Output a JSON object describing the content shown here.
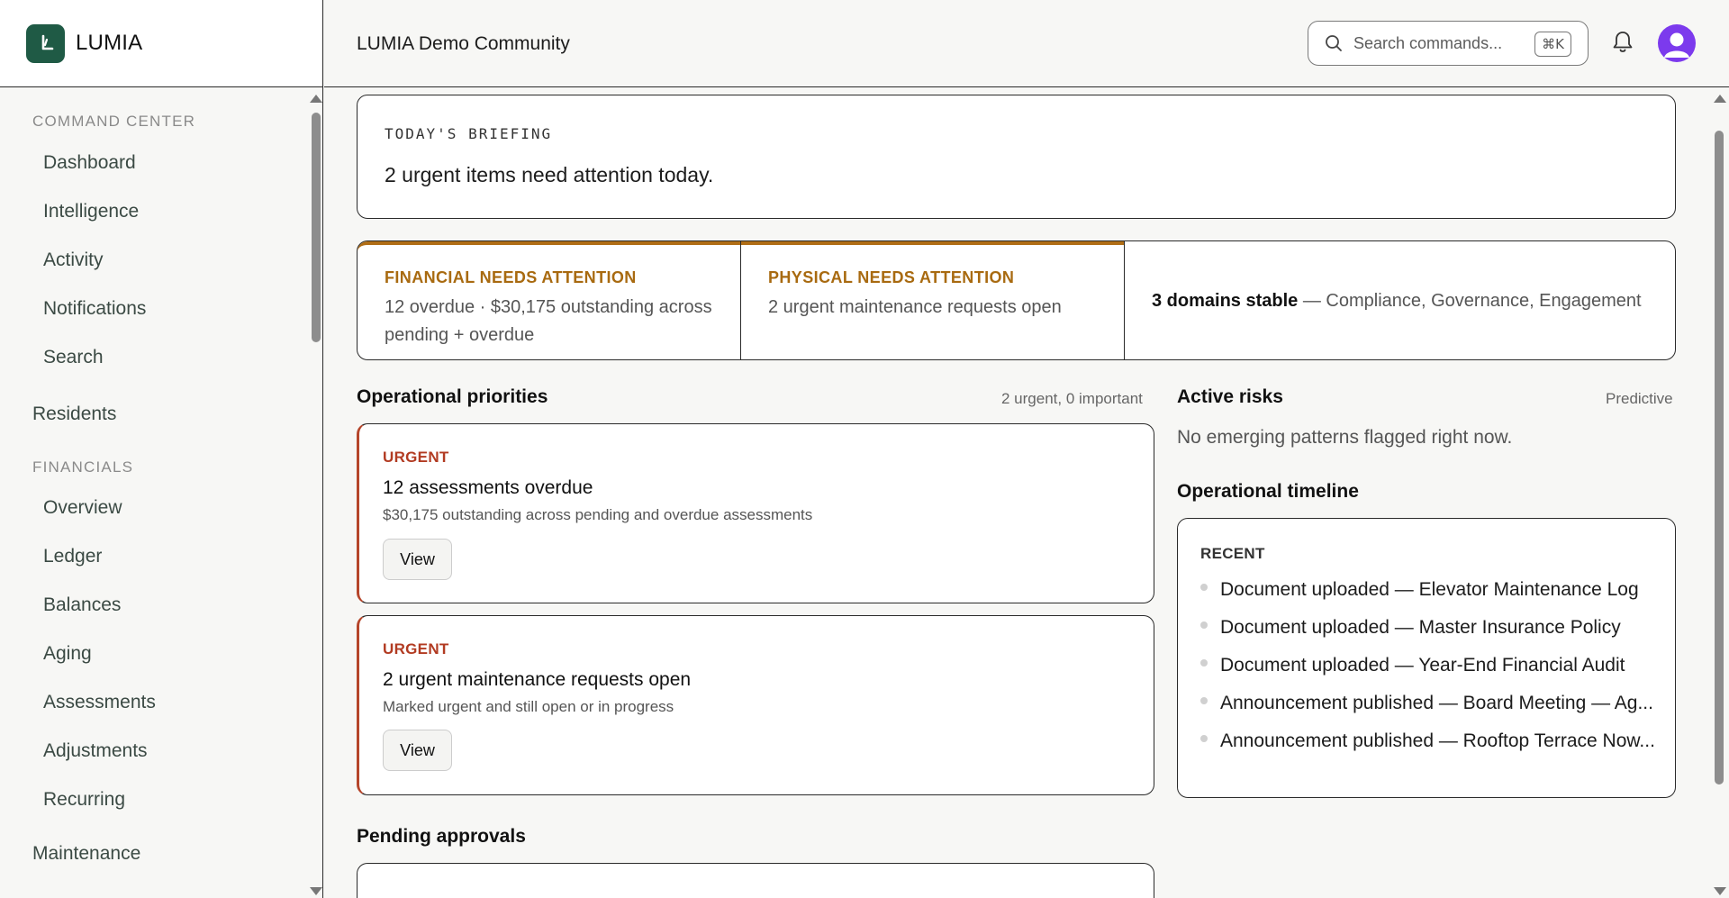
{
  "brand": {
    "name": "LUMIA"
  },
  "sidebar": {
    "sections": [
      {
        "label": "COMMAND CENTER",
        "items": [
          "Dashboard",
          "Intelligence",
          "Activity",
          "Notifications",
          "Search"
        ]
      },
      {
        "label": "Residents"
      },
      {
        "label": "FINANCIALS",
        "items": [
          "Overview",
          "Ledger",
          "Balances",
          "Aging",
          "Assessments",
          "Adjustments",
          "Recurring"
        ]
      },
      {
        "label": "Maintenance"
      }
    ]
  },
  "header": {
    "community": "LUMIA Demo Community",
    "search_placeholder": "Search commands...",
    "shortcut": "⌘K"
  },
  "briefing": {
    "eyebrow": "TODAY'S BRIEFING",
    "message": "2 urgent items need attention today."
  },
  "status": {
    "financial": {
      "title": "FINANCIAL NEEDS ATTENTION",
      "body": "12 overdue · $30,175 outstanding across pending + overdue"
    },
    "physical": {
      "title": "PHYSICAL NEEDS ATTENTION",
      "body": "2 urgent maintenance requests open"
    },
    "stable": {
      "strong": "3 domains stable",
      "rest": " — Compliance, Governance, Engagement"
    }
  },
  "priorities": {
    "title": "Operational priorities",
    "meta": "2 urgent, 0 important",
    "items": [
      {
        "tag": "URGENT",
        "title": "12 assessments overdue",
        "desc": "$30,175 outstanding across pending and overdue assessments",
        "action": "View"
      },
      {
        "tag": "URGENT",
        "title": "2 urgent maintenance requests open",
        "desc": "Marked urgent and still open or in progress",
        "action": "View"
      }
    ]
  },
  "risks": {
    "title": "Active risks",
    "meta": "Predictive",
    "empty": "No emerging patterns flagged right now."
  },
  "timeline": {
    "title": "Operational timeline",
    "label": "RECENT",
    "items": [
      "Document uploaded — Elevator Maintenance Log",
      "Document uploaded — Master Insurance Policy",
      "Document uploaded — Year-End Financial Audit",
      "Announcement published — Board Meeting — Ag...",
      "Announcement published — Rooftop Terrace Now..."
    ]
  },
  "approvals": {
    "title": "Pending approvals"
  },
  "colors": {
    "brand": "#1f5a45",
    "warning": "#a86a10",
    "urgent": "#b23b22",
    "avatar": "#7c3aed"
  }
}
